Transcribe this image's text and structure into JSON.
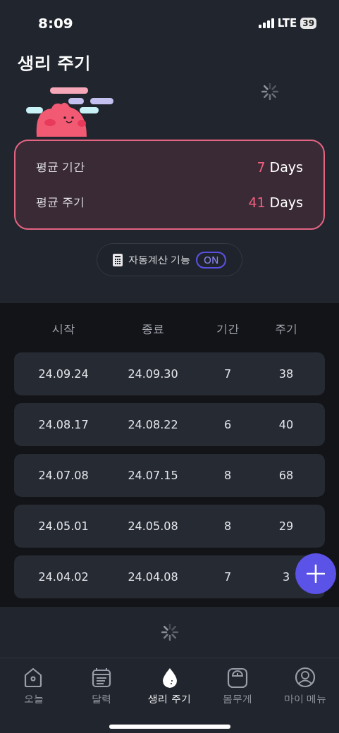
{
  "status_bar": {
    "time": "8:09",
    "network": "LTE",
    "battery": "39"
  },
  "header": {
    "title": "생리 주기"
  },
  "summary": [
    {
      "label": "평균 기간",
      "value": "7",
      "unit": "Days"
    },
    {
      "label": "평균 주기",
      "value": "41",
      "unit": "Days"
    }
  ],
  "auto_calc": {
    "label": "자동계산 기능",
    "state": "ON",
    "on": true
  },
  "table": {
    "columns": [
      "시작",
      "종료",
      "기간",
      "주기"
    ],
    "rows": [
      [
        "24.09.24",
        "24.09.30",
        "7",
        "38"
      ],
      [
        "24.08.17",
        "24.08.22",
        "6",
        "40"
      ],
      [
        "24.07.08",
        "24.07.15",
        "8",
        "68"
      ],
      [
        "24.05.01",
        "24.05.08",
        "8",
        "29"
      ],
      [
        "24.04.02",
        "24.04.08",
        "7",
        "3"
      ]
    ]
  },
  "tabs": [
    {
      "label": "오늘",
      "selected": false
    },
    {
      "label": "달력",
      "selected": false
    },
    {
      "label": "생리 주기",
      "selected": true
    },
    {
      "label": "몸무게",
      "selected": false
    },
    {
      "label": "마이 메뉴",
      "selected": false
    }
  ]
}
